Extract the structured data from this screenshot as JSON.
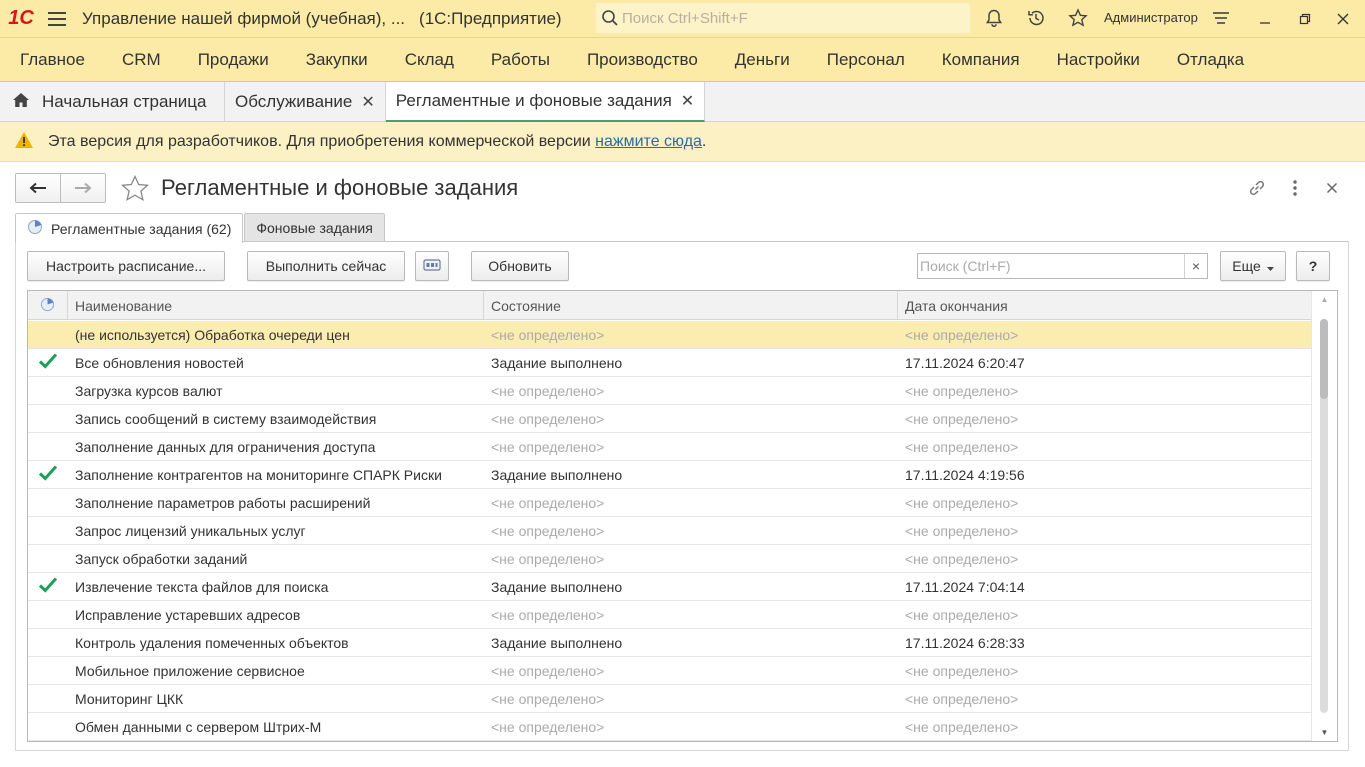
{
  "app": {
    "logo": "1С",
    "title": "Управление нашей фирмой (учебная), ...",
    "suffix": "(1С:Предприятие)",
    "search_placeholder": "Поиск Ctrl+Shift+F",
    "user": "Администратор"
  },
  "sections": [
    "Главное",
    "CRM",
    "Продажи",
    "Закупки",
    "Склад",
    "Работы",
    "Производство",
    "Деньги",
    "Персонал",
    "Компания",
    "Настройки",
    "Отладка"
  ],
  "open_tabs": {
    "home": "Начальная страница",
    "items": [
      {
        "label": "Обслуживание"
      },
      {
        "label": "Регламентные и фоновые задания"
      }
    ]
  },
  "banner": {
    "text": "Эта версия для разработчиков. Для приобретения коммерческой версии",
    "link": "нажмите сюда",
    "tail": "."
  },
  "form": {
    "title": "Регламентные и фоновые задания",
    "tabs": [
      "Регламентные задания (62)",
      "Фоновые задания"
    ],
    "buttons": {
      "schedule": "Настроить расписание...",
      "run_now": "Выполнить сейчас",
      "refresh": "Обновить",
      "more": "Еще",
      "help": "?"
    },
    "search_placeholder": "Поиск (Ctrl+F)",
    "search_clear": "×",
    "columns": [
      "Наименование",
      "Состояние",
      "Дата окончания"
    ],
    "rows": [
      {
        "done": false,
        "name": "(не используется) Обработка очереди цен",
        "state": "<не определено>",
        "date": "<не определено>"
      },
      {
        "done": true,
        "name": "Все обновления новостей",
        "state": "Задание выполнено",
        "date": "17.11.2024 6:20:47"
      },
      {
        "done": false,
        "name": "Загрузка курсов валют",
        "state": "<не определено>",
        "date": "<не определено>"
      },
      {
        "done": false,
        "name": "Запись сообщений в систему взаимодействия",
        "state": "<не определено>",
        "date": "<не определено>"
      },
      {
        "done": false,
        "name": "Заполнение данных для ограничения доступа",
        "state": "<не определено>",
        "date": "<не определено>"
      },
      {
        "done": true,
        "name": "Заполнение контрагентов на мониторинге СПАРК Риски",
        "state": "Задание выполнено",
        "date": "17.11.2024 4:19:56"
      },
      {
        "done": false,
        "name": "Заполнение параметров работы расширений",
        "state": "<не определено>",
        "date": "<не определено>"
      },
      {
        "done": false,
        "name": "Запрос лицензий уникальных услуг",
        "state": "<не определено>",
        "date": "<не определено>"
      },
      {
        "done": false,
        "name": "Запуск обработки заданий",
        "state": "<не определено>",
        "date": "<не определено>"
      },
      {
        "done": true,
        "name": "Извлечение текста файлов для поиска",
        "state": "Задание выполнено",
        "date": "17.11.2024 7:04:14"
      },
      {
        "done": false,
        "name": "Исправление устаревших адресов",
        "state": "<не определено>",
        "date": "<не определено>"
      },
      {
        "done": false,
        "name": "Контроль удаления помеченных объектов",
        "state": "Задание выполнено",
        "date": "17.11.2024 6:28:33"
      },
      {
        "done": false,
        "name": "Мобильное приложение сервисное",
        "state": "<не определено>",
        "date": "<не определено>"
      },
      {
        "done": false,
        "name": "Мониторинг ЦКК",
        "state": "<не определено>",
        "date": "<не определено>"
      },
      {
        "done": false,
        "name": "Обмен данными с сервером Штрих-М",
        "state": "<не определено>",
        "date": "<не определено>"
      }
    ]
  },
  "colors": {
    "panel_yellow": "#fbeba6",
    "selected_row": "#fbedb0",
    "check_green": "#1f9d55",
    "link": "#2a6aa8"
  }
}
